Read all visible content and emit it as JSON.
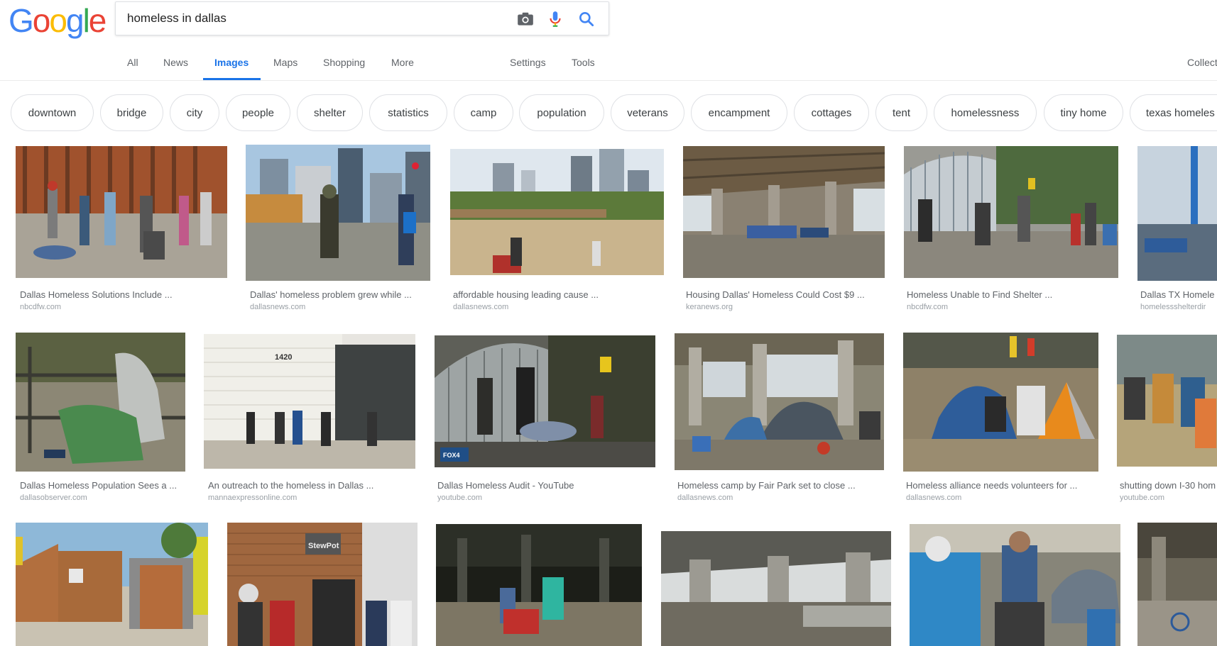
{
  "logo": {
    "letters": [
      "G",
      "o",
      "o",
      "g",
      "l",
      "e"
    ],
    "colors": [
      "#4285F4",
      "#EA4335",
      "#FBBC05",
      "#4285F4",
      "#34A853",
      "#EA4335"
    ]
  },
  "search": {
    "query": "homeless in dallas",
    "icons": [
      "camera-icon",
      "microphone-icon",
      "search-icon"
    ]
  },
  "tabs": [
    "All",
    "News",
    "Images",
    "Maps",
    "Shopping",
    "More"
  ],
  "active_tab": "Images",
  "tools": [
    "Settings",
    "Tools"
  ],
  "collections_label": "Collect",
  "chips": [
    "downtown",
    "bridge",
    "city",
    "people",
    "shelter",
    "statistics",
    "camp",
    "population",
    "veterans",
    "encampment",
    "cottages",
    "tent",
    "homelessness",
    "tiny home",
    "texas homeles"
  ],
  "results_row1": [
    {
      "caption": "Dallas Homeless Solutions Include ...",
      "domain": "nbcdfw.com"
    },
    {
      "caption": "Dallas' homeless problem grew while ...",
      "domain": "dallasnews.com"
    },
    {
      "caption": "affordable housing leading cause ...",
      "domain": "dallasnews.com"
    },
    {
      "caption": "Housing Dallas' Homeless Could Cost $9 ...",
      "domain": "keranews.org"
    },
    {
      "caption": "Homeless Unable to Find Shelter ...",
      "domain": "nbcdfw.com"
    },
    {
      "caption": "Dallas TX Homele",
      "domain": "homelessshelterdir"
    }
  ],
  "results_row2": [
    {
      "caption": "Dallas Homeless Population Sees a ...",
      "domain": "dallasobserver.com"
    },
    {
      "caption": "An outreach to the homeless in Dallas ...",
      "domain": "mannaexpressonline.com"
    },
    {
      "caption": "Dallas Homeless Audit - YouTube",
      "domain": "youtube.com"
    },
    {
      "caption": "Homeless camp by Fair Park set to close ...",
      "domain": "dallasnews.com"
    },
    {
      "caption": "Homeless alliance needs volunteers for ...",
      "domain": "dallasnews.com"
    },
    {
      "caption": "shutting down I-30 hom",
      "domain": "youtube.com"
    }
  ],
  "image_text": {
    "building_number": "1420",
    "stewpot_sign": "StewPot",
    "tv_logo": "FOX4"
  }
}
